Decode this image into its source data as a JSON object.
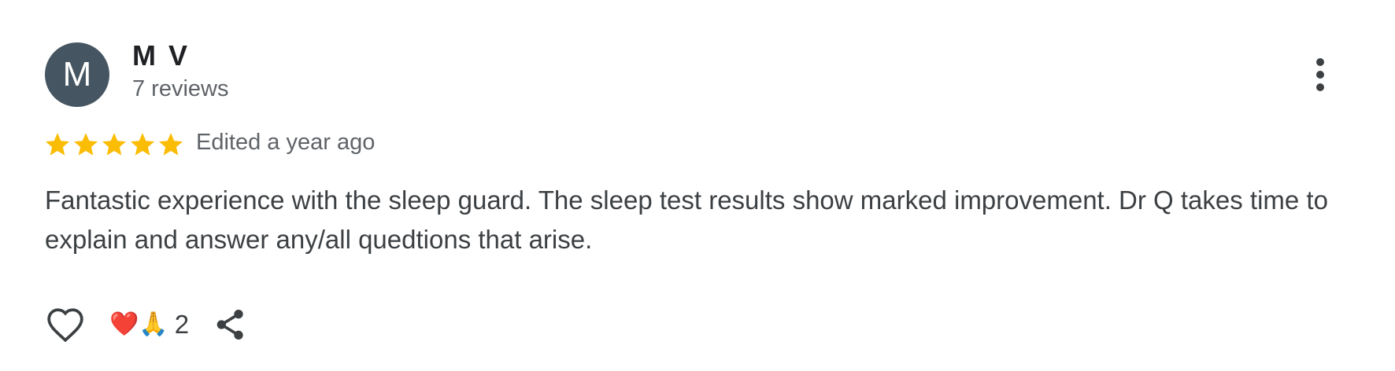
{
  "review": {
    "author": {
      "avatar_initial": "M",
      "avatar_color": "#455561",
      "name": "M V",
      "review_count": "7 reviews"
    },
    "rating": {
      "stars": 5,
      "max_stars": 5,
      "star_color": "#fbbc04"
    },
    "edited_label": "Edited a year ago",
    "text": "Fantastic experience with the sleep guard. The sleep test results show marked improvement. Dr Q takes time to explain and answer any/all quedtions that arise.",
    "actions": {
      "like_icon": "heart-outline-icon",
      "reactions": {
        "emojis": "❤️🙏",
        "count": "2"
      },
      "share_icon": "share-icon",
      "more_icon": "more-vert-icon"
    }
  }
}
